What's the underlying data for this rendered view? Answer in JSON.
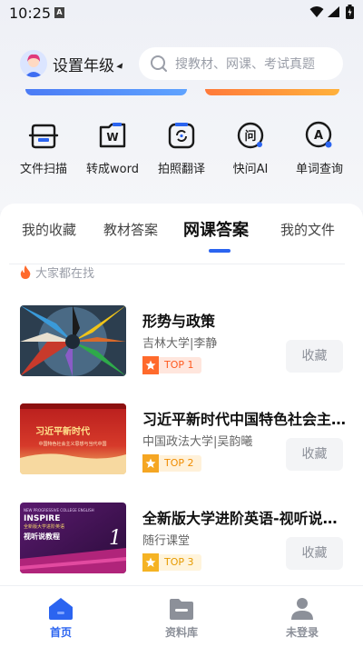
{
  "status": {
    "time": "10:25",
    "sim_label": "A"
  },
  "header": {
    "grade_label": "设置年级",
    "search_placeholder": "搜教材、网课、考试真题"
  },
  "tools": [
    {
      "label": "文件扫描",
      "icon": "scan-icon"
    },
    {
      "label": "转成word",
      "icon": "word-icon"
    },
    {
      "label": "拍照翻译",
      "icon": "translate-icon"
    },
    {
      "label": "快问AI",
      "icon": "ai-chat-icon"
    },
    {
      "label": "单词查询",
      "icon": "word-lookup-icon"
    }
  ],
  "tabs": [
    {
      "label": "我的收藏",
      "active": false
    },
    {
      "label": "教材答案",
      "active": false
    },
    {
      "label": "网课答案",
      "active": true
    },
    {
      "label": "我的文件",
      "active": false
    }
  ],
  "hot": {
    "label": "大家都在找"
  },
  "items": [
    {
      "title": "形势与政策",
      "subtitle": "吉林大学|李静",
      "rank": "TOP 1",
      "collect": "收藏"
    },
    {
      "title": "习近平新时代中国特色社会主...",
      "subtitle": "中国政法大学|吴韵曦",
      "rank": "TOP 2",
      "collect": "收藏",
      "thumb_text": "习近平新时代",
      "thumb_sub": "中国特色社会主义思想与当代中国"
    },
    {
      "title": "全新版大学进阶英语-视听说教...",
      "subtitle": "随行课堂",
      "rank": "TOP 3",
      "collect": "收藏",
      "thumb_top": "NEW PROGRESSIVE COLLEGE ENGLISH",
      "thumb_brand": "INSPIRE",
      "thumb_cn1": "全新版大学进阶英语",
      "thumb_cn2": "视听说教程",
      "thumb_num": "1"
    }
  ],
  "nav": [
    {
      "label": "首页",
      "active": true
    },
    {
      "label": "资料库",
      "active": false
    },
    {
      "label": "未登录",
      "active": false
    }
  ],
  "colors": {
    "accent": "#2b64f0",
    "inactive": "#8c9099",
    "rank_orange": "#ff6a2c",
    "rank_yellow": "#f5a623"
  }
}
